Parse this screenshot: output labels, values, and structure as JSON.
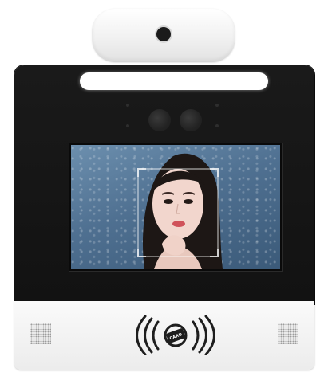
{
  "device": {
    "card_reader": {
      "label": "CARD",
      "icon": "contactless-card-icon"
    },
    "colors": {
      "housing_black": "#151515",
      "housing_white": "#f4f4f4",
      "light_bar": "#ffffff",
      "screen_background": "#4f7091"
    },
    "icons": [
      "camera-lens-icon",
      "contactless-card-icon",
      "speaker-grille-icon"
    ]
  }
}
